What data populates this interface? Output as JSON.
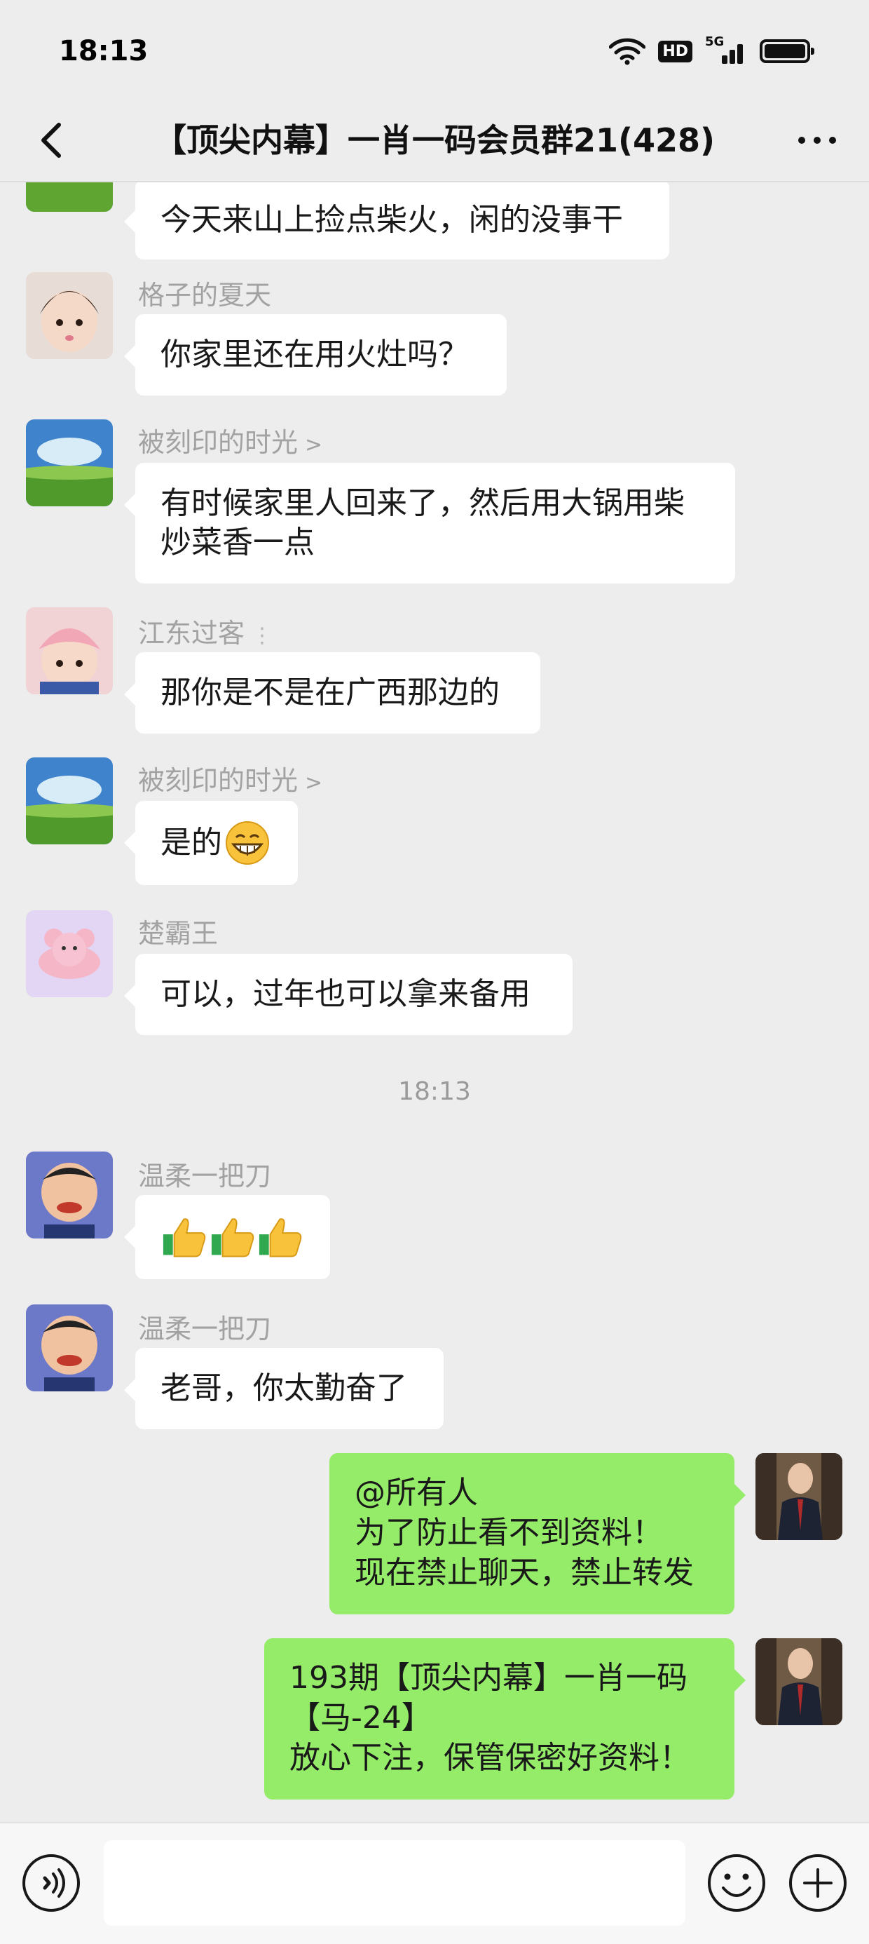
{
  "status_bar": {
    "time": "18:13",
    "hd_label": "HD",
    "network_label": "5G"
  },
  "header": {
    "title": "【顶尖内幕】一肖一码会员群21(428)"
  },
  "messages": [
    {
      "text": "今天来山上捡点柴火，闲的没事干"
    },
    {
      "sender": "格子的夏天",
      "text": "你家里还在用火灶吗？"
    },
    {
      "sender": "被刻印的时光",
      "text_line1": "有时候家里人回来了，然后用大锅用柴",
      "text_line2": "炒菜香一点"
    },
    {
      "sender": "江东过客",
      "text": "那你是不是在广西那边的"
    },
    {
      "sender": "被刻印的时光",
      "text": "是的",
      "emoji": "grin-emoji"
    },
    {
      "sender": "楚霸王",
      "text": "可以，过年也可以拿来备用"
    },
    {
      "timestamp": "18:13"
    },
    {
      "sender": "温柔一把刀",
      "emoji": "thumbs-up-icon x3"
    },
    {
      "sender": "温柔一把刀",
      "text": "老哥，你太勤奋了"
    },
    {
      "from_self": true,
      "line1": "@所有人",
      "line2": "为了防止看不到资料！",
      "line3": "现在禁止聊天，禁止转发"
    },
    {
      "from_self": true,
      "line1": "193期【顶尖内幕】一肖一码",
      "line2": "【马-24】",
      "line3": "放心下注，保管保密好资料！"
    }
  ],
  "colors": {
    "background": "#ededed",
    "bubble_in": "#ffffff",
    "bubble_out": "#95ec69",
    "nickname": "#a2a2a2"
  },
  "icons": {
    "back": "chevron-left-icon",
    "more": "more-dots-icon",
    "voice": "voice-icon",
    "emoji": "emoji-icon",
    "plus": "plus-icon"
  }
}
